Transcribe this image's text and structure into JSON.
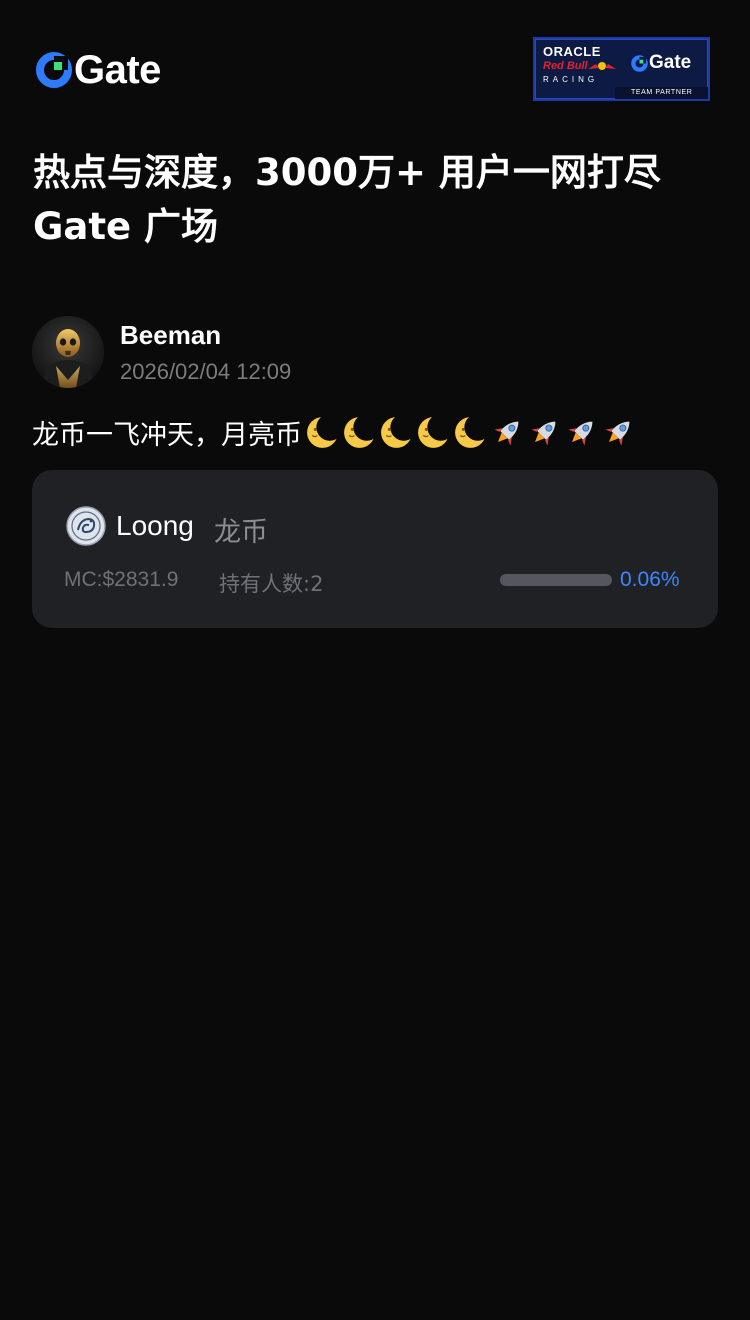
{
  "brand": {
    "logo_text": "Gate",
    "accent_color": "#2f7bff",
    "partner_badge": {
      "oracle": "ORACLE",
      "redbull": "Red Bull",
      "racing": "RACING",
      "gate": "Gate",
      "team_partner": "TEAM PARTNER"
    }
  },
  "headline": {
    "line1": "热点与深度，3000万+ 用户一网打尽",
    "line2": "Gate 广场"
  },
  "post": {
    "author": "Beeman",
    "time": "2026/02/04 12:09",
    "text": "龙币一飞冲天，月亮币",
    "emojis": [
      "moon-emoji",
      "moon-emoji",
      "moon-emoji",
      "moon-emoji",
      "moon-emoji",
      "rocket-emoji",
      "rocket-emoji",
      "rocket-emoji",
      "rocket-emoji"
    ]
  },
  "token": {
    "name": "Loong",
    "cn_name": "龙币",
    "market_cap": "MC:$2831.9",
    "holders": "持有人数:2",
    "progress_percent": 0.06,
    "progress_label": "0.06%"
  }
}
